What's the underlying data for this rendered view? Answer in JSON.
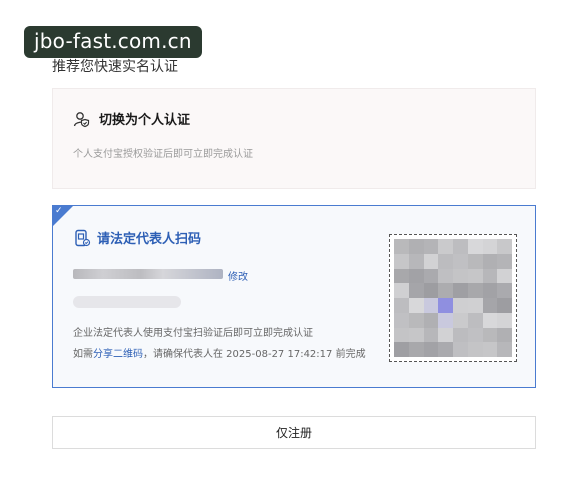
{
  "watermark": "jbo-fast.com.cn",
  "section_title": "推荐您快速实名认证",
  "personal": {
    "title": "切换为个人认证",
    "desc": "个人支付宝授权验证后即可立即完成认证",
    "icon": "user-shield-icon"
  },
  "legal": {
    "title": "请法定代表人扫码",
    "icon": "phone-scan-icon",
    "modify_label": "修改",
    "desc": "企业法定代表人使用支付宝扫验证后即可立即完成认证",
    "share_prefix": "如需",
    "share_link": "分享二维码",
    "share_suffix": "，请确保代表人在 2025-08-27 17:42:17 前完成",
    "selected": true
  },
  "register_only": "仅注册",
  "colors": {
    "accent": "#2d5fb5",
    "border_selected": "#4a7bd0",
    "watermark_bg": "#2b3a30"
  }
}
